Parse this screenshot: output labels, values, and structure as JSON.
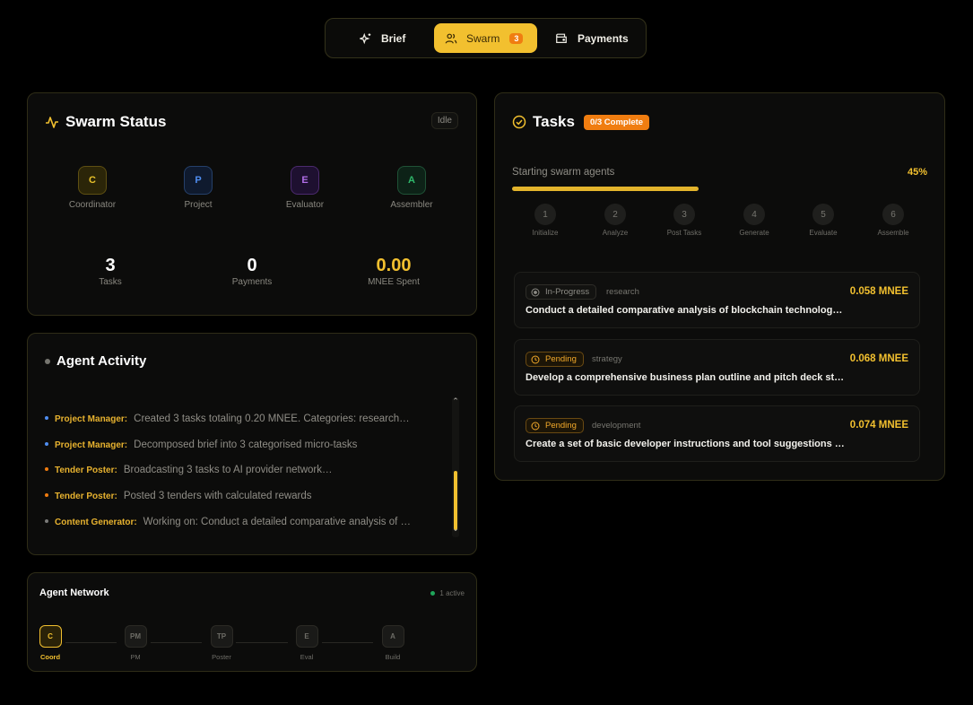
{
  "nav": {
    "brief_label": "Brief",
    "swarm_label": "Swarm",
    "swarm_count": "3",
    "payments_label": "Payments"
  },
  "swarm_status": {
    "title": "Swarm Status",
    "state": "Idle",
    "roles": [
      {
        "letter": "C",
        "label": "Coordinator",
        "color": "#e9c22a"
      },
      {
        "letter": "P",
        "label": "Project",
        "color": "#4f8df0"
      },
      {
        "letter": "E",
        "label": "Evaluator",
        "color": "#b16ee8"
      },
      {
        "letter": "A",
        "label": "Assembler",
        "color": "#2fb96b"
      }
    ],
    "stats": [
      {
        "value": "3",
        "label": "Tasks"
      },
      {
        "value": "0",
        "label": "Payments"
      },
      {
        "value": "0.00",
        "label": "MNEE Spent"
      }
    ]
  },
  "activity": {
    "title": "Agent Activity",
    "items": [
      {
        "who": "Project Manager:",
        "msg": "Created 3 tasks totaling 0.20 MNEE. Categories: research…",
        "dot": "#4f8df0"
      },
      {
        "who": "Project Manager:",
        "msg": "Decomposed brief into 3 categorised micro-tasks",
        "dot": "#4f8df0"
      },
      {
        "who": "Tender Poster:",
        "msg": "Broadcasting 3 tasks to AI provider network…",
        "dot": "#f07d10"
      },
      {
        "who": "Tender Poster:",
        "msg": "Posted 3 tenders with calculated rewards",
        "dot": "#f07d10"
      },
      {
        "who": "Content Generator:",
        "msg": "Working on: Conduct a detailed comparative analysis of …",
        "dot": "#7a7a78"
      }
    ],
    "scroll_up": "⌃",
    "scroll_down": "⌄"
  },
  "network": {
    "title": "Agent Network",
    "active": "1 active",
    "nodes": [
      {
        "code": "C",
        "label": "Coord",
        "active": true
      },
      {
        "code": "PM",
        "label": "PM",
        "active": false
      },
      {
        "code": "TP",
        "label": "Poster",
        "active": false
      },
      {
        "code": "E",
        "label": "Eval",
        "active": false
      },
      {
        "code": "A",
        "label": "Build",
        "active": false
      }
    ]
  },
  "tasks": {
    "title": "Tasks",
    "complete": "0/3 Complete",
    "progress_label": "Starting swarm agents",
    "progress_pct": "45%",
    "progress_fraction": 0.45,
    "steps": [
      {
        "n": "1",
        "label": "Initialize"
      },
      {
        "n": "2",
        "label": "Analyze"
      },
      {
        "n": "3",
        "label": "Post Tasks"
      },
      {
        "n": "4",
        "label": "Generate"
      },
      {
        "n": "5",
        "label": "Evaluate"
      },
      {
        "n": "6",
        "label": "Assemble"
      }
    ],
    "items": [
      {
        "status": "In-Progress",
        "category": "research",
        "amount": "0.058 MNEE",
        "desc": "Conduct a detailed comparative analysis of blockchain technologies and their use cases"
      },
      {
        "status": "Pending",
        "category": "strategy",
        "amount": "0.068 MNEE",
        "desc": "Develop a comprehensive business plan outline and pitch deck structure"
      },
      {
        "status": "Pending",
        "category": "development",
        "amount": "0.074 MNEE",
        "desc": "Create a set of basic developer instructions and tool suggestions for"
      }
    ]
  }
}
